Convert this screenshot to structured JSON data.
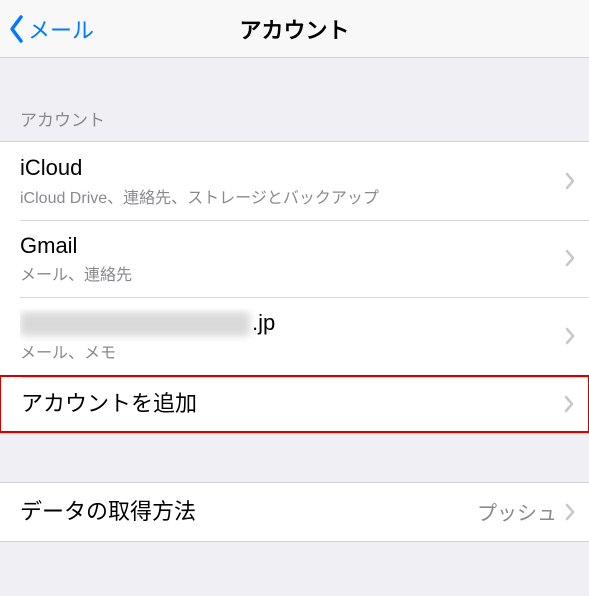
{
  "navbar": {
    "back_label": "メール",
    "title": "アカウント"
  },
  "section_header": "アカウント",
  "accounts": [
    {
      "title": "iCloud",
      "subtitle": "iCloud Drive、連絡先、ストレージとバックアップ"
    },
    {
      "title": "Gmail",
      "subtitle": "メール、連絡先"
    },
    {
      "title_suffix": ".jp",
      "subtitle": "メール、メモ",
      "redacted": true
    }
  ],
  "add_account_label": "アカウントを追加",
  "fetch": {
    "label": "データの取得方法",
    "value": "プッシュ"
  }
}
